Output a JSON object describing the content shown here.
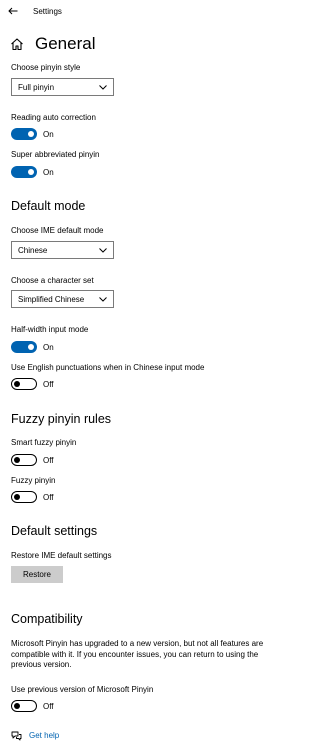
{
  "window": {
    "title": "Settings"
  },
  "page": {
    "title": "General"
  },
  "sections": {
    "pinyin_style": {
      "label": "Choose pinyin style",
      "value": "Full pinyin"
    },
    "reading_auto_correction": {
      "label": "Reading auto correction",
      "state": "On"
    },
    "super_abbreviated": {
      "label": "Super abbreviated pinyin",
      "state": "On"
    },
    "default_mode": {
      "heading": "Default mode",
      "ime_mode_label": "Choose IME default mode",
      "ime_mode_value": "Chinese",
      "charset_label": "Choose a character set",
      "charset_value": "Simplified Chinese",
      "half_width_label": "Half-width input mode",
      "half_width_state": "On",
      "english_punct_label": "Use English punctuations when in Chinese input mode",
      "english_punct_state": "Off"
    },
    "fuzzy": {
      "heading": "Fuzzy pinyin rules",
      "smart_label": "Smart fuzzy pinyin",
      "smart_state": "Off",
      "fuzzy_label": "Fuzzy pinyin",
      "fuzzy_state": "Off"
    },
    "default_settings": {
      "heading": "Default settings",
      "restore_label": "Restore IME default settings",
      "restore_button": "Restore"
    },
    "compatibility": {
      "heading": "Compatibility",
      "description": "Microsoft Pinyin has upgraded to a new version, but not all features are compatible with it. If you encounter issues, you can return to using the previous version.",
      "previous_label": "Use previous version of Microsoft Pinyin",
      "previous_state": "Off"
    }
  },
  "help": {
    "label": "Get help"
  },
  "colors": {
    "accent": "#0063b1",
    "button_bg": "#cccccc",
    "border": "#7a7a7a"
  },
  "icons": {
    "back": "back-arrow-icon",
    "home": "home-icon",
    "dropdown": "chevron-down-icon",
    "help": "chat-help-icon"
  }
}
